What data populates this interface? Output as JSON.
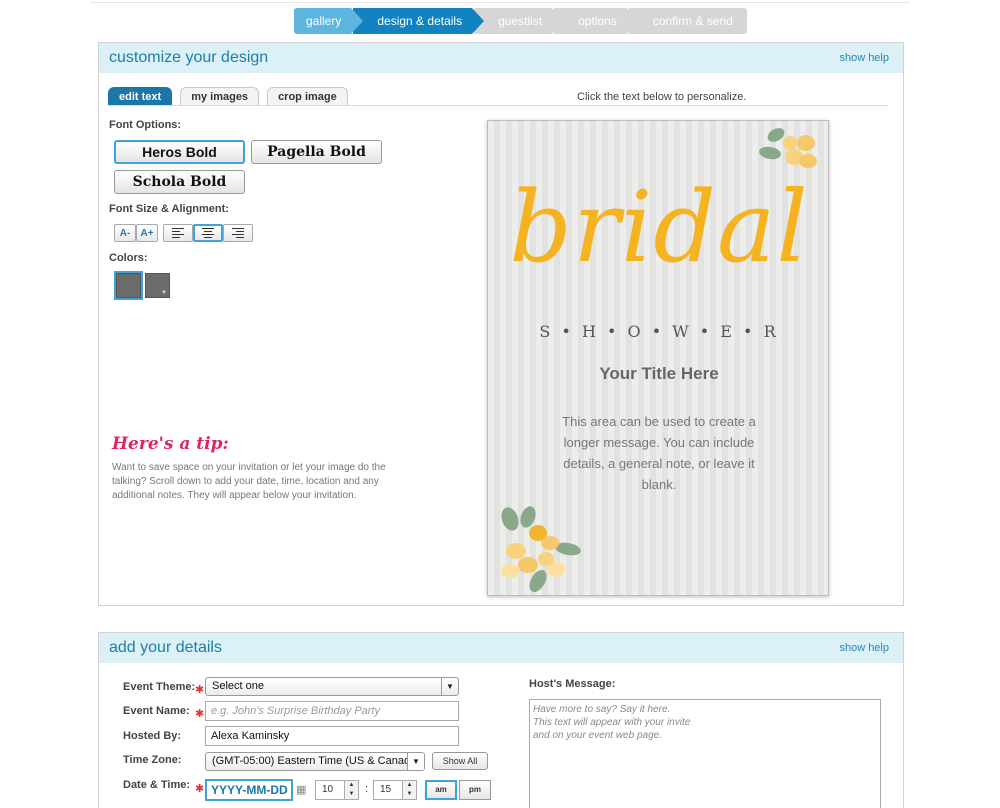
{
  "wizard": {
    "steps": [
      "gallery",
      "design & details",
      "guestlist",
      "options",
      "confirm & send"
    ]
  },
  "design": {
    "title": "customize your design",
    "show_help": "show help",
    "tabs": [
      "edit text",
      "my images",
      "crop image"
    ],
    "hint": "Click the text below to personalize.",
    "font_options_label": "Font Options:",
    "fonts": [
      "Heros Bold",
      "Pagella Bold",
      "Schola Bold"
    ],
    "size_align_label": "Font Size & Alignment:",
    "size_buttons": [
      "A-",
      "A+"
    ],
    "colors_label": "Colors:",
    "colors": [
      "#6b6b6b",
      "#6b6b6b"
    ],
    "tip_title": "Here's a tip:",
    "tip_text": "Want to save space on your invitation or let your image do the talking? Scroll down to add your date, time, location and any additional notes. They will appear below your invitation.",
    "card": {
      "headline": "bridal",
      "subheadline": "S • H • O • W • E • R",
      "title": "Your Title Here",
      "message": "This area can be used to create a longer message. You can include details, a general note, or leave it blank.",
      "accent_color": "#f5b321"
    }
  },
  "details": {
    "title": "add your details",
    "show_help": "show help",
    "event_theme_label": "Event Theme:",
    "event_theme_value": "Select one",
    "event_name_label": "Event Name:",
    "event_name_placeholder": "e.g. John's Surprise Birthday Party",
    "hosted_by_label": "Hosted By:",
    "hosted_by_value": "Alexa Kaminsky",
    "time_zone_label": "Time Zone:",
    "time_zone_value": "(GMT-05:00) Eastern Time (US & Canad",
    "show_all": "Show All",
    "date_time_label": "Date & Time:",
    "date_value": "YYYY-MM-DD",
    "hour": "10",
    "minute": "15",
    "time_sep": ":",
    "am": "am",
    "pm": "pm",
    "host_message_label": "Host's Message:",
    "host_message_placeholder": "Have more to say? Say it here.\nThis text will appear with your invite\nand on your event web page."
  }
}
